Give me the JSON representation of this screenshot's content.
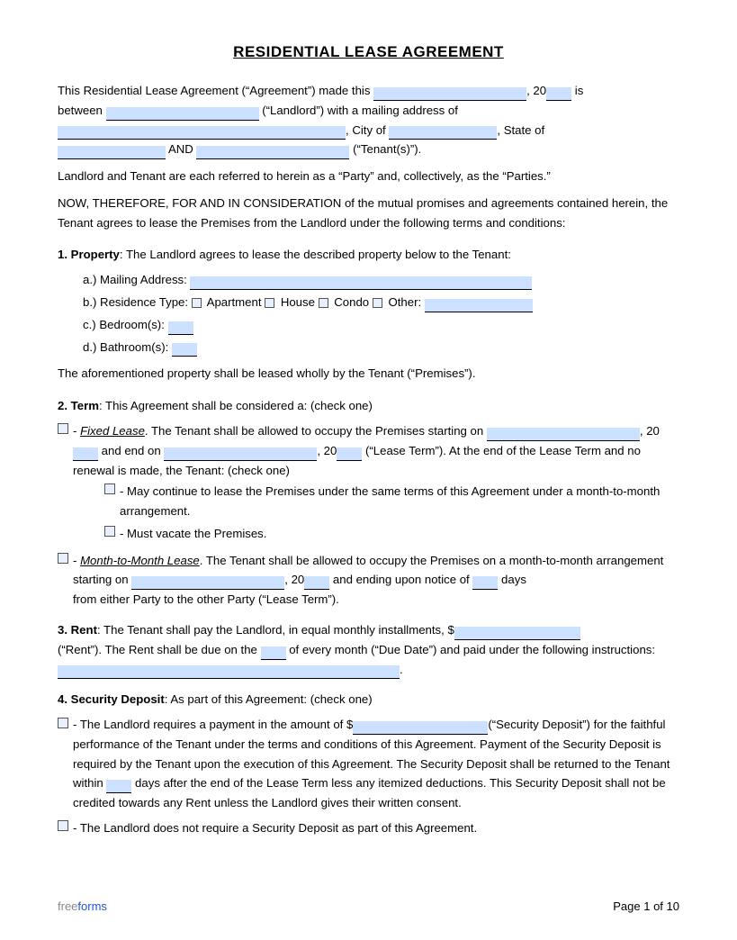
{
  "title": "RESIDENTIAL LEASE AGREEMENT",
  "intro": {
    "line1": "This Residential Lease Agreement (“Agreement”) made this",
    "year_prefix": ", 20",
    "year_suffix": " is",
    "between": "between",
    "landlord_suffix": "(“Landlord”) with a mailing address of",
    "city_prefix": ", City of",
    "state_suffix": ", State of",
    "and_label": "AND",
    "tenant_suffix": "(“Tenant(s)”)."
  },
  "parties_note": "Landlord and Tenant are each referred to herein as a “Party” and, collectively, as the “Parties.”",
  "consideration": "NOW, THEREFORE, FOR AND IN CONSIDERATION of the mutual promises and agreements contained herein, the Tenant agrees to lease the Premises from the Landlord under the following terms and conditions:",
  "section1": {
    "header": "1. Property",
    "text": ": The Landlord agrees to lease the described property below to the Tenant:",
    "a_label": "a.)  Mailing Address:",
    "b_label": "b.)  Residence Type:",
    "b_options": [
      "Apartment",
      "House",
      "Condo",
      "Other:"
    ],
    "c_label": "c.)  Bedroom(s):",
    "d_label": "d.)  Bathroom(s):",
    "premises_note": "The aforementioned property shall be leased wholly by the Tenant (“Premises”)."
  },
  "section2": {
    "header": "2. Term",
    "text": ": This Agreement shall be considered a: (check one)",
    "fixed_label": "- ",
    "fixed_italic": "Fixed Lease",
    "fixed_text": ". The Tenant shall be allowed to occupy the Premises starting on",
    "fixed_year1": ", 20",
    "fixed_and": " and end on",
    "fixed_year2": ", 20",
    "fixed_lease_term": " (“Lease Term”). At the end of the Lease Term and no renewal is made, the Tenant: (check one)",
    "option1": "- May continue to lease the Premises under the same terms of this Agreement under a month-to-month arrangement.",
    "option2": "- Must vacate the Premises.",
    "month_label": "- ",
    "month_italic": "Month-to-Month Lease",
    "month_text": ". The Tenant shall be allowed to occupy the Premises on a month-to-month arrangement starting on",
    "month_year": ", 20",
    "month_notice": " and ending upon notice of",
    "month_days": " days",
    "month_end": "from either Party to the other Party (“Lease Term”)."
  },
  "section3": {
    "header": "3. Rent",
    "text": ": The Tenant shall pay the Landlord, in equal monthly installments, $",
    "rent_end": "(“Rent”). The Rent shall be due on the",
    "due_date": " of every month (“Due Date”) and paid under the following instructions:",
    "period": "."
  },
  "section4": {
    "header": "4. Security Deposit",
    "text": ": As part of this Agreement: (check one)",
    "requires_label": "- The Landlord requires a payment in the amount of $",
    "requires_end": "(“Security Deposit”) for the faithful performance of the Tenant under the terms and conditions of this Agreement. Payment of the Security Deposit is required by the Tenant upon the execution of this Agreement. The Security Deposit shall be returned to the Tenant within",
    "days_label": " days after the end of the Lease Term less any itemized deductions. This Security Deposit shall not be credited towards any Rent unless the Landlord gives their written consent.",
    "no_deposit": "- The Landlord does not require a Security Deposit as part of this Agreement."
  },
  "footer": {
    "brand_free": "free",
    "brand_forms": "forms",
    "page_label": "Page 1 of 10"
  }
}
